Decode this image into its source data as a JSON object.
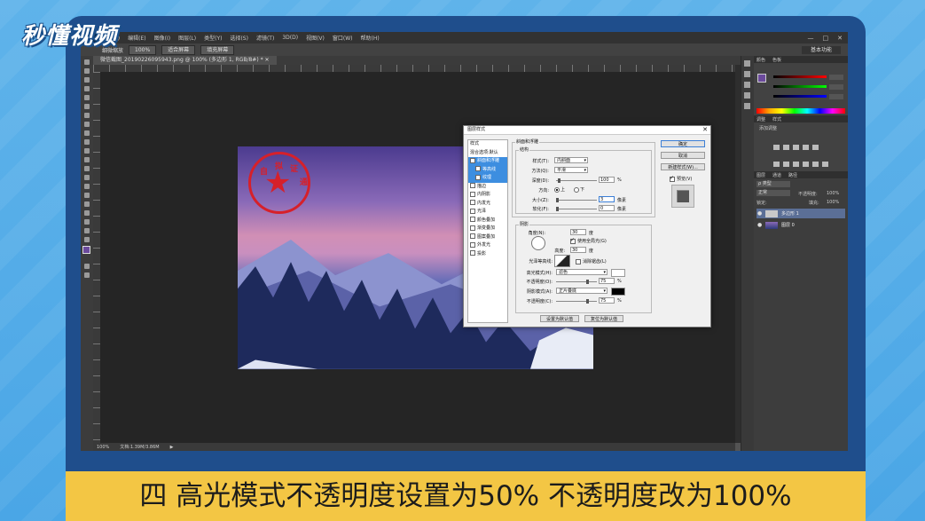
{
  "watermark": {
    "text": "秒懂视频"
  },
  "caption": {
    "text": "四 高光模式不透明度设置为50% 不透明度改为100%"
  },
  "ps": {
    "app_badge": "Ps",
    "menu": [
      "文件(F)",
      "编辑(E)",
      "图像(I)",
      "图层(L)",
      "类型(Y)",
      "选择(S)",
      "滤镜(T)",
      "3D(D)",
      "视图(V)",
      "窗口(W)",
      "帮助(H)"
    ],
    "window_controls": [
      "—",
      "□",
      "✕"
    ],
    "options": {
      "label": "细微缩放",
      "zoom": "100%",
      "fit_btn": "适合屏幕",
      "fill_btn": "填充屏幕",
      "workspace": "基本功能"
    },
    "doc_tab": "微信截图_20190226095943.png @ 100% (多边形 1, RGB/8#) * ✕",
    "status": {
      "zoom": "100%",
      "doc": "文档:1.39M/3.86M"
    },
    "panels": {
      "color_tabs": [
        "颜色",
        "色板"
      ],
      "adjust_tabs": [
        "调整",
        "样式"
      ],
      "adjust_label": "添加调整",
      "layer_tabs": [
        "图层",
        "通道",
        "路径"
      ],
      "kind": "ρ 类型",
      "blend": "正常",
      "opacity_label": "不透明度:",
      "opacity": "100%",
      "lock_label": "锁定:",
      "fill_label": "填充:",
      "fill": "100%",
      "layers": [
        {
          "name": "多边形 1",
          "selected": true
        },
        {
          "name": "图层 0",
          "selected": false
        }
      ],
      "colors": {
        "fg": "#6b4a9c"
      }
    },
    "stamp": {
      "chars": [
        "自",
        "拟",
        "证",
        "通"
      ]
    }
  },
  "dialog": {
    "title": "图层样式",
    "close": "✕",
    "styles_header": "样式",
    "styles_blend": "混合选项:默认",
    "styles": [
      {
        "label": "斜面和浮雕",
        "checked": true,
        "active": true,
        "sub": false
      },
      {
        "label": "等高线",
        "checked": false,
        "active": true,
        "sub": true
      },
      {
        "label": "纹理",
        "checked": false,
        "active": true,
        "sub": true
      },
      {
        "label": "描边",
        "checked": false,
        "active": false,
        "sub": false
      },
      {
        "label": "内阴影",
        "checked": false,
        "active": false,
        "sub": false
      },
      {
        "label": "内发光",
        "checked": false,
        "active": false,
        "sub": false
      },
      {
        "label": "光泽",
        "checked": false,
        "active": false,
        "sub": false
      },
      {
        "label": "颜色叠加",
        "checked": false,
        "active": false,
        "sub": false
      },
      {
        "label": "渐变叠加",
        "checked": false,
        "active": false,
        "sub": false
      },
      {
        "label": "图案叠加",
        "checked": false,
        "active": false,
        "sub": false
      },
      {
        "label": "外发光",
        "checked": false,
        "active": false,
        "sub": false
      },
      {
        "label": "投影",
        "checked": false,
        "active": false,
        "sub": false
      }
    ],
    "bevel": {
      "group": "斜面和浮雕",
      "structure": "结构",
      "style_label": "样式(T):",
      "style": "内斜面",
      "method_label": "方法(Q):",
      "method": "平滑",
      "depth_label": "深度(D):",
      "depth": "100",
      "depth_unit": "%",
      "direction_label": "方向:",
      "dir_up": "上",
      "dir_down": "下",
      "size_label": "大小(Z):",
      "size": "3",
      "size_unit": "像素",
      "soften_label": "软化(F):",
      "soften": "0",
      "soften_unit": "像素"
    },
    "shading": {
      "group": "阴影",
      "angle_label": "角度(N):",
      "angle": "30",
      "angle_unit": "度",
      "global_light": "使用全局光(G)",
      "altitude_label": "高度:",
      "altitude": "30",
      "altitude_unit": "度",
      "gloss_label": "光泽等高线:",
      "antialias": "消除锯齿(L)",
      "highlight_label": "高光模式(H):",
      "highlight_mode": "滤色",
      "hl_opacity_label": "不透明度(O):",
      "hl_opacity": "75",
      "hl_unit": "%",
      "shadow_label": "阴影模式(A):",
      "shadow_mode": "正片叠底",
      "sh_opacity_label": "不透明度(C):",
      "sh_opacity": "75",
      "sh_unit": "%",
      "highlight_color": "#ffffff",
      "shadow_color": "#000000"
    },
    "buttons": {
      "ok": "确定",
      "cancel": "取消",
      "new_style": "新建样式(W)...",
      "preview": "预览(V)",
      "set_default": "设置为默认值",
      "reset_default": "复位为默认值"
    }
  }
}
